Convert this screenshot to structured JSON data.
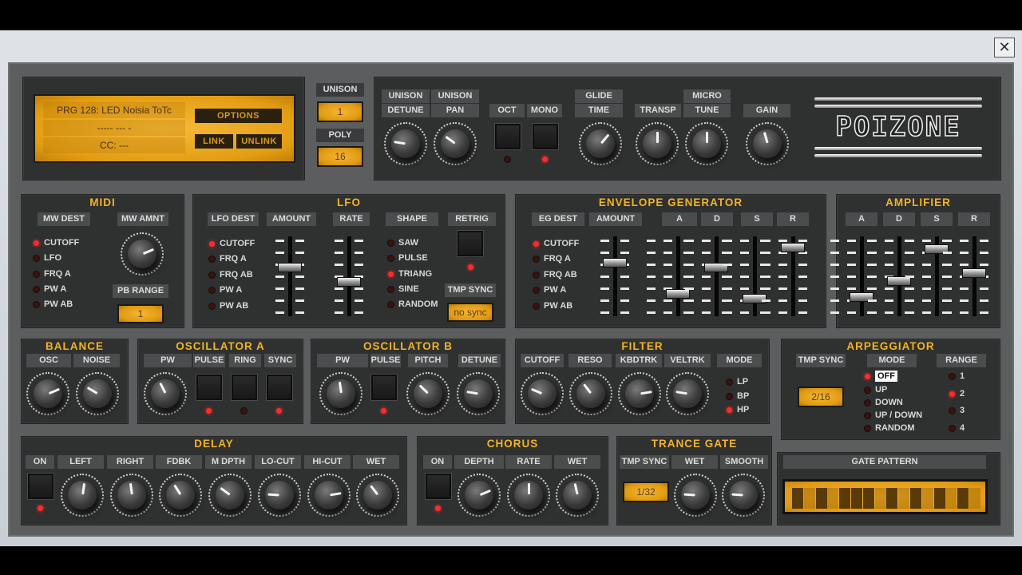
{
  "window": {
    "close_icon": "close-icon",
    "close_glyph": "✕"
  },
  "display": {
    "program": "PRG 128: LED Noisia ToTc",
    "line2": "-----  --- -",
    "cc": "CC: ---",
    "options": "OPTIONS",
    "link": "LINK",
    "unlink": "UNLINK"
  },
  "voice": {
    "unison_label": "UNISON",
    "unison_value": "1",
    "poly_label": "POLY",
    "poly_value": "16"
  },
  "global": {
    "unison_detune": {
      "top": "UNISON",
      "label": "DETUNE",
      "value": 0.2
    },
    "unison_pan": {
      "top": "UNISON",
      "label": "PAN",
      "value": 0.3
    },
    "oct": {
      "label": "OCT",
      "on": false
    },
    "mono": {
      "label": "MONO",
      "on": true
    },
    "glide_time": {
      "top": "GLIDE",
      "label": "TIME",
      "value": 0.65
    },
    "transp": {
      "label": "TRANSP",
      "value": 0.5
    },
    "micro_tune": {
      "top": "MICRO",
      "label": "TUNE",
      "value": 0.5
    },
    "gain": {
      "label": "GAIN",
      "value": 0.44
    }
  },
  "logo": "POIZONE",
  "midi": {
    "title": "MIDI",
    "dest_label": "MW DEST",
    "dests": [
      "CUTOFF",
      "LFO",
      "FRQ A",
      "PW A",
      "PW AB"
    ],
    "dest_active": 0,
    "amnt_label": "MW AMNT",
    "amnt": 0.75,
    "pb_label": "PB RANGE",
    "pb_value": "1"
  },
  "lfo": {
    "title": "LFO",
    "dest_label": "LFO DEST",
    "dests": [
      "CUTOFF",
      "FRQ A",
      "FRQ AB",
      "PW A",
      "PW AB"
    ],
    "dest_active": 0,
    "amount_label": "AMOUNT",
    "amount": 0.63,
    "rate_label": "RATE",
    "rate": 0.42,
    "shape_label": "SHAPE",
    "shapes": [
      "SAW",
      "PULSE",
      "TRIANG",
      "SINE",
      "RANDOM"
    ],
    "shape_active": 2,
    "retrig_label": "RETRIG",
    "retrig_on": true,
    "sync_label": "TMP SYNC",
    "sync_value": "no sync"
  },
  "eg": {
    "title": "ENVELOPE GENERATOR",
    "dest_label": "EG DEST",
    "dests": [
      "CUTOFF",
      "FRQ A",
      "FRQ AB",
      "PW A",
      "PW AB"
    ],
    "dest_active": 0,
    "amount_label": "AMOUNT",
    "amount": 0.7,
    "adsr": [
      {
        "label": "A",
        "value": 0.25
      },
      {
        "label": "D",
        "value": 0.63
      },
      {
        "label": "S",
        "value": 0.17
      },
      {
        "label": "R",
        "value": 0.92
      }
    ]
  },
  "amp": {
    "title": "AMPLIFIER",
    "adsr": [
      {
        "label": "A",
        "value": 0.2
      },
      {
        "label": "D",
        "value": 0.43
      },
      {
        "label": "S",
        "value": 0.9
      },
      {
        "label": "R",
        "value": 0.55
      }
    ]
  },
  "balance": {
    "title": "BALANCE",
    "osc": {
      "label": "OSC",
      "value": 0.75
    },
    "noise": {
      "label": "NOISE",
      "value": 0.28
    }
  },
  "osc_a": {
    "title": "OSCILLATOR A",
    "pw": {
      "label": "PW",
      "value": 0.4
    },
    "pulse": {
      "label": "PULSE",
      "on": true
    },
    "ring": {
      "label": "RING",
      "on": false
    },
    "sync": {
      "label": "SYNC",
      "on": true
    }
  },
  "osc_b": {
    "title": "OSCILLATOR B",
    "pw": {
      "label": "PW",
      "value": 0.47
    },
    "pulse": {
      "label": "PULSE",
      "on": true
    },
    "pitch": {
      "label": "PITCH",
      "value": 0.33
    },
    "detune": {
      "label": "DETUNE",
      "value": 0.2
    }
  },
  "filter": {
    "title": "FILTER",
    "cutoff": {
      "label": "CUTOFF",
      "value": 0.25
    },
    "reso": {
      "label": "RESO",
      "value": 0.36
    },
    "kbdtrk": {
      "label": "KBDTRK",
      "value": 0.8
    },
    "veltrk": {
      "label": "VELTRK",
      "value": 0.2
    },
    "mode_label": "MODE",
    "modes": [
      "LP",
      "BP",
      "HP"
    ],
    "mode_active": 2
  },
  "arp": {
    "title": "ARPEGGIATOR",
    "sync_label": "TMP SYNC",
    "sync_value": "2/16",
    "mode_label": "MODE",
    "modes": [
      "OFF",
      "UP",
      "DOWN",
      "UP / DOWN",
      "RANDOM"
    ],
    "mode_active": 0,
    "range_label": "RANGE",
    "ranges": [
      "1",
      "2",
      "3",
      "4"
    ],
    "range_active": 1
  },
  "delay": {
    "title": "DELAY",
    "on_label": "ON",
    "on": true,
    "knobs": [
      {
        "label": "LEFT",
        "value": 0.53
      },
      {
        "label": "RIGHT",
        "value": 0.47
      },
      {
        "label": "FDBK",
        "value": 0.38
      },
      {
        "label": "M DPTH",
        "value": 0.3
      },
      {
        "label": "LO-CUT",
        "value": 0.18
      },
      {
        "label": "HI-CUT",
        "value": 0.8
      },
      {
        "label": "WET",
        "value": 0.36
      }
    ]
  },
  "chorus": {
    "title": "CHORUS",
    "on_label": "ON",
    "on": true,
    "knobs": [
      {
        "label": "DEPTH",
        "value": 0.75
      },
      {
        "label": "RATE",
        "value": 0.5
      },
      {
        "label": "WET",
        "value": 0.45
      }
    ]
  },
  "trance_gate": {
    "title": "TRANCE GATE",
    "sync_label": "TMP SYNC",
    "sync_value": "1/32",
    "wet": {
      "label": "WET",
      "value": 0.18
    },
    "smooth": {
      "label": "SMOOTH",
      "value": 0.18
    },
    "pattern_label": "GATE PATTERN",
    "pattern": [
      1,
      0,
      1,
      0,
      1,
      1,
      1,
      0,
      1,
      0,
      1,
      0,
      1,
      0,
      1,
      0
    ]
  },
  "colors": {
    "accent": "#f2b422",
    "lcd": "#e8a41a",
    "led_on": "#ff2a2a",
    "panel": "#2f3030",
    "chassis": "#5b5d5f"
  }
}
